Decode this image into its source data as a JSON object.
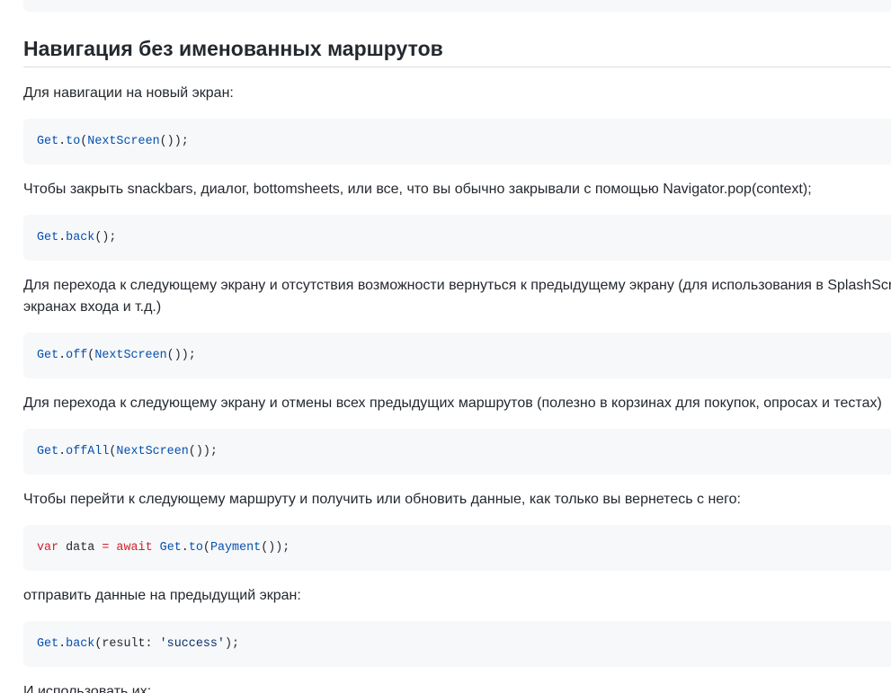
{
  "heading": "Навигация без именованных маршрутов",
  "blocks": [
    {
      "text": "Для навигации на новый экран:",
      "code": [
        {
          "t": "Get",
          "k": "obj"
        },
        {
          "t": ".",
          "k": "pl"
        },
        {
          "t": "to",
          "k": "obj"
        },
        {
          "t": "(",
          "k": "pl"
        },
        {
          "t": "NextScreen",
          "k": "cls"
        },
        {
          "t": "());",
          "k": "pl"
        }
      ]
    },
    {
      "text": "Чтобы закрыть snackbars, диалог, bottomsheets, или все, что вы обычно закрывали с помощью Navigator.pop(context);",
      "code": [
        {
          "t": "Get",
          "k": "obj"
        },
        {
          "t": ".",
          "k": "pl"
        },
        {
          "t": "back",
          "k": "obj"
        },
        {
          "t": "();",
          "k": "pl"
        }
      ]
    },
    {
      "text_lines": [
        "Для перехода к следующему экрану и отсутствия возможности вернуться к предыдущему экрану (для использования в SplashScreens,",
        "экранах входа и т.д.)"
      ],
      "code": [
        {
          "t": "Get",
          "k": "obj"
        },
        {
          "t": ".",
          "k": "pl"
        },
        {
          "t": "off",
          "k": "obj"
        },
        {
          "t": "(",
          "k": "pl"
        },
        {
          "t": "NextScreen",
          "k": "cls"
        },
        {
          "t": "());",
          "k": "pl"
        }
      ]
    },
    {
      "text": "Для перехода к следующему экрану и отмены всех предыдущих маршрутов (полезно в корзинах для покупок, опросах и тестах)",
      "code": [
        {
          "t": "Get",
          "k": "obj"
        },
        {
          "t": ".",
          "k": "pl"
        },
        {
          "t": "offAll",
          "k": "obj"
        },
        {
          "t": "(",
          "k": "pl"
        },
        {
          "t": "NextScreen",
          "k": "cls"
        },
        {
          "t": "());",
          "k": "pl"
        }
      ]
    },
    {
      "text": "Чтобы перейти к следующему маршруту и получить или обновить данные, как только вы вернетесь с него:",
      "code": [
        {
          "t": "var",
          "k": "kw"
        },
        {
          "t": " data ",
          "k": "id"
        },
        {
          "t": "=",
          "k": "op"
        },
        {
          "t": " ",
          "k": "pl"
        },
        {
          "t": "await",
          "k": "kw"
        },
        {
          "t": " ",
          "k": "pl"
        },
        {
          "t": "Get",
          "k": "obj"
        },
        {
          "t": ".",
          "k": "pl"
        },
        {
          "t": "to",
          "k": "obj"
        },
        {
          "t": "(",
          "k": "pl"
        },
        {
          "t": "Payment",
          "k": "cls"
        },
        {
          "t": "());",
          "k": "pl"
        }
      ]
    },
    {
      "text": "отправить данные на предыдущий экран:",
      "code": [
        {
          "t": "Get",
          "k": "obj"
        },
        {
          "t": ".",
          "k": "pl"
        },
        {
          "t": "back",
          "k": "obj"
        },
        {
          "t": "(result: ",
          "k": "pl"
        },
        {
          "t": "'success'",
          "k": "str"
        },
        {
          "t": ");",
          "k": "pl"
        }
      ]
    }
  ],
  "trailing_text": "И использовать их:"
}
